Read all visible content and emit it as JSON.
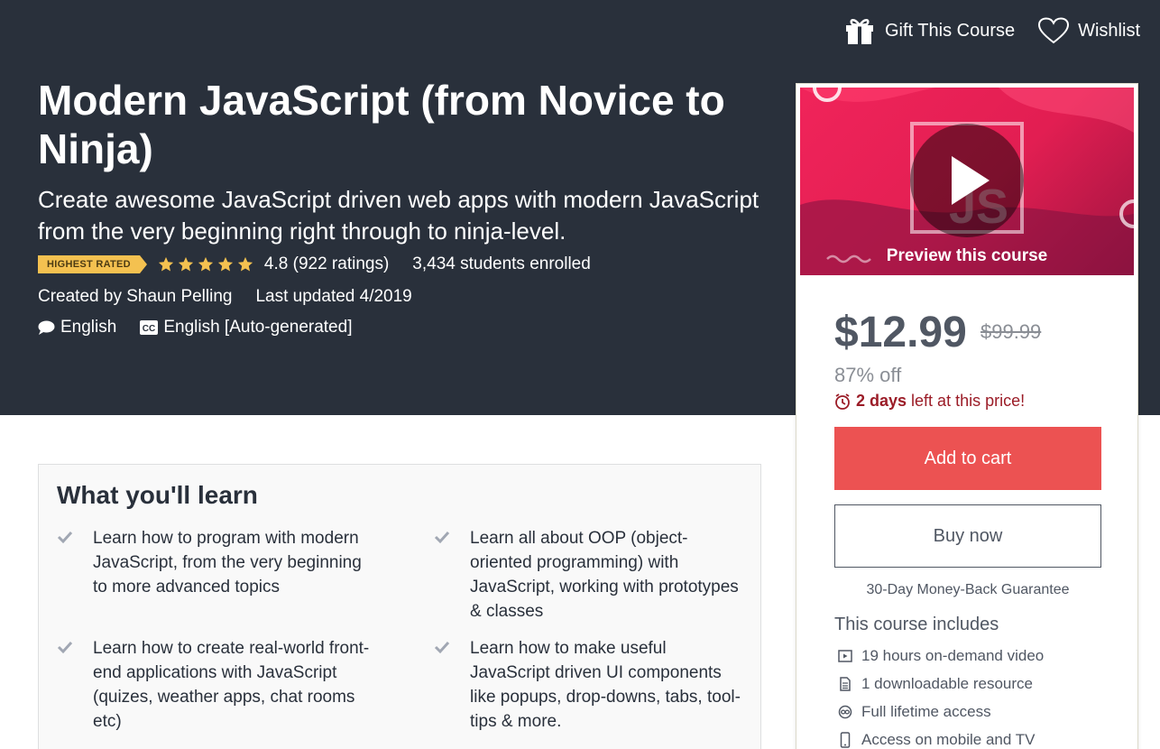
{
  "header": {
    "gift_label": "Gift This Course",
    "wishlist_label": "Wishlist"
  },
  "course": {
    "title": "Modern JavaScript (from Novice to Ninja)",
    "subtitle": "Create awesome JavaScript driven web apps with modern JavaScript from the very beginning right through to ninja-level.",
    "badge": "HIGHEST RATED",
    "stars": 5,
    "rating": "4.8 (922 ratings)",
    "enrolled": "3,434 students enrolled",
    "created_by": "Created by Shaun Pelling",
    "last_updated": "Last updated 4/2019",
    "language": "English",
    "captions": "English [Auto-generated]"
  },
  "sidebar": {
    "preview_label": "Preview this course",
    "price": "$12.99",
    "original_price": "$99.99",
    "discount": "87% off",
    "timer_bold": "2 days",
    "timer_rest": " left at this price!",
    "add_to_cart": "Add to cart",
    "buy_now": "Buy now",
    "guarantee": "30-Day Money-Back Guarantee",
    "includes_title": "This course includes",
    "includes": [
      {
        "icon": "video-icon",
        "label": "19 hours on-demand video"
      },
      {
        "icon": "file-icon",
        "label": "1 downloadable resource"
      },
      {
        "icon": "infinity-icon",
        "label": "Full lifetime access"
      },
      {
        "icon": "mobile-icon",
        "label": "Access on mobile and TV"
      }
    ]
  },
  "learn": {
    "title": "What you'll learn",
    "items": [
      "Learn how to program with modern JavaScript, from the very beginning to more advanced topics",
      "Learn all about OOP (object-oriented programming) with JavaScript, working with prototypes & classes",
      "Learn how to create real-world front-end applications with JavaScript (quizes, weather apps, chat rooms etc)",
      "Learn how to make useful JavaScript driven UI components like popups, drop-downs, tabs, tool-tips & more."
    ]
  },
  "colors": {
    "hero_bg": "#29303b",
    "accent_red": "#ec5252",
    "star": "#f4c150",
    "timer_red": "#9b1c27"
  }
}
